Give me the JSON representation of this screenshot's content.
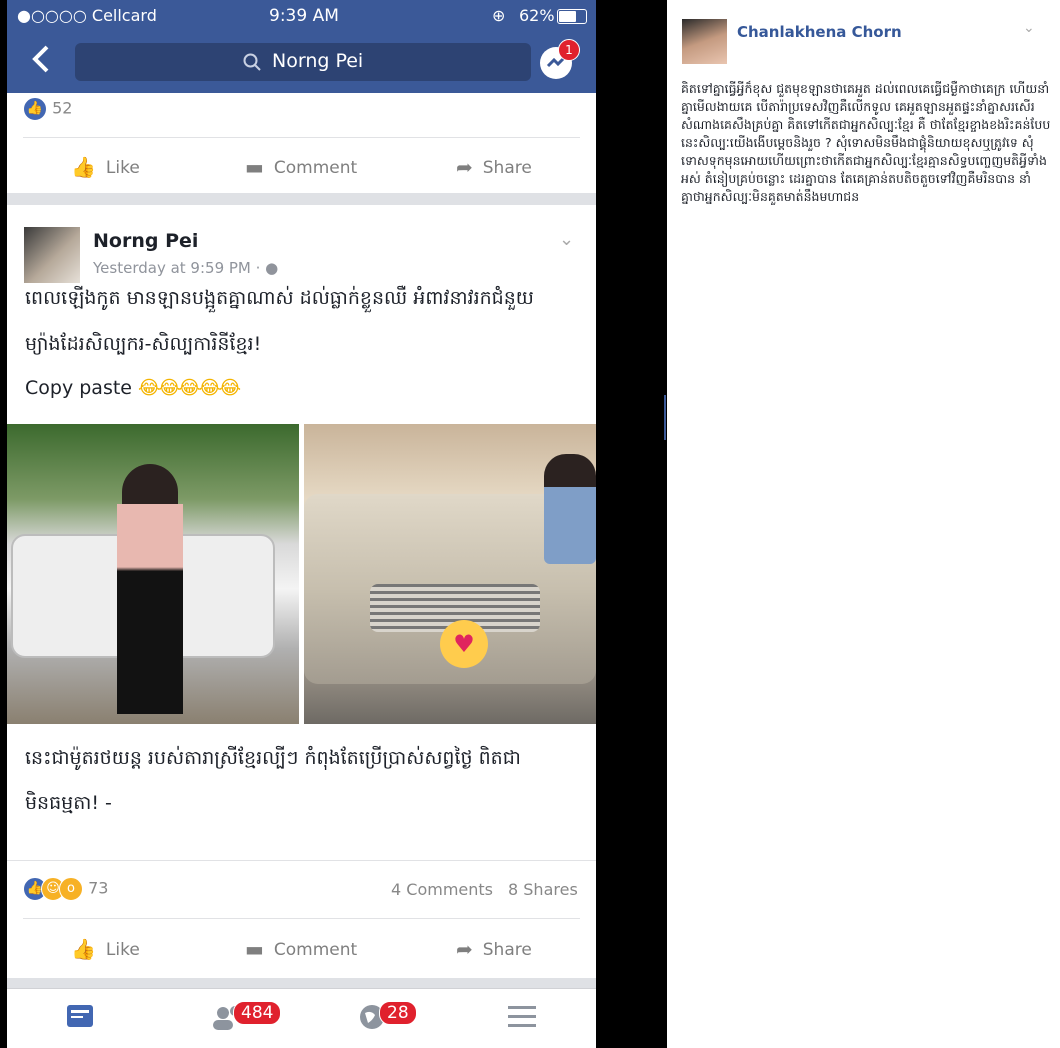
{
  "status_bar": {
    "carrier": "●○○○○ Cellcard",
    "time": "9:39 AM",
    "battery": "62%"
  },
  "navbar": {
    "search_value": "Norng Pei",
    "messenger_badge": "1"
  },
  "top_card": {
    "reaction_count": "52",
    "like": "Like",
    "comment": "Comment",
    "share": "Share"
  },
  "post": {
    "author": "Norng Pei",
    "time": "Yesterday at 9:59 PM · ",
    "text_line1": "ពេលឡើងកូត មានឡានបង្អួតគ្នាណាស់ ដល់ធ្លាក់ខ្លួនឈឺ អំពាវនាវរកជំនួយ",
    "text_line2": "ម្យ៉ាងដែរសិល្បករ-សិល្បការិនីខ្មែរ!",
    "text_line3": "Copy paste",
    "emojis": "😂😂😂😂😂",
    "caption_line1": "នេះជាម៉ូតរថយន្ត របស់តារាស្រីខ្មែរល្បីៗ កំពុងតែប្រើប្រាស់សព្វថ្ងៃ ពិតជា",
    "caption_line2": "មិនធម្មតា! -",
    "reaction_count": "73",
    "comments": "4 Comments",
    "shares": "8 Shares",
    "like": "Like",
    "comment": "Comment",
    "share": "Share"
  },
  "tabbar": {
    "friends_badge": "484",
    "notifications_badge": "28"
  },
  "right_panel": {
    "name": "Chanlakhena Chorn",
    "text": "គិតទៅគ្នាធ្វើអ្វីក៏ខុស ជួតមុខឡានថាគេអួត ដល់ពេលគេធ្វើជម្ងឺកាថាគេក្រ ហើយនាំគ្នាមើលងាយគេ បើតារ៉ាប្រទេសវិញគឺលើកទូល គេអួតឡានអួតផ្ទះនាំគ្នាសរសើរសំណាងគេសឹងគ្រប់គ្នា គិតទៅកើតជាអ្នកសិល្បៈខ្មែរ គឺ ថាតែខ្មែរខ្ចាងខងរិះគន់បែបនេះសិល្បៈយើងងើបម្តេចនិងរួច ? សុំទោសមិនមឹងជាផ្គុំនិយាយខុសឬត្រូវទេ សុំទោសទុកមុនអោយហើយព្រោះថាកើតជាអ្នកសិល្បៈខ្មែរគ្មានសិទ្ធបញ្ចេញមតិអ្វីទាំងអស់ តំនៀបគ្រប់ចន្លោះ ដេរគ្នាបាន តែគេគ្រាន់តបតិចតួចទៅវិញគឺមរិនបាន នាំគ្នាថាអ្នកសិល្បៈមិនគួតមាត់នឹងមហាជន"
  }
}
